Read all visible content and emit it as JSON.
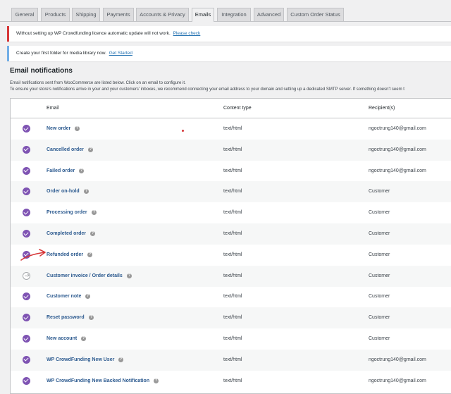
{
  "tabs": [
    {
      "label": "General"
    },
    {
      "label": "Products"
    },
    {
      "label": "Shipping"
    },
    {
      "label": "Payments"
    },
    {
      "label": "Accounts & Privacy"
    },
    {
      "label": "Emails"
    },
    {
      "label": "Integration"
    },
    {
      "label": "Advanced"
    },
    {
      "label": "Custom Order Status"
    }
  ],
  "active_tab": "Emails",
  "notices": {
    "licence_text": "Without setting up WP Crowdfunding licence automatic update will not work.",
    "licence_link": "Please check",
    "folder_text": "Create your first folder for media library now.",
    "folder_link": "Get Started"
  },
  "section": {
    "title": "Email notifications",
    "desc1": "Email notifications sent from WooCommerce are listed below. Click on an email to configure it.",
    "desc2": "To ensure your store's notifications arrive in your and your customers' inboxes, we recommend connecting your email address to your domain and setting up a dedicated SMTP server. If something doesn't seem t"
  },
  "table": {
    "headers": {
      "email": "Email",
      "content_type": "Content type",
      "recipients": "Recipient(s)"
    },
    "rows": [
      {
        "name": "New order",
        "type": "text/html",
        "recipient": "ngoctrung140@gmail.com",
        "status": "enabled"
      },
      {
        "name": "Cancelled order",
        "type": "text/html",
        "recipient": "ngoctrung140@gmail.com",
        "status": "enabled"
      },
      {
        "name": "Failed order",
        "type": "text/html",
        "recipient": "ngoctrung140@gmail.com",
        "status": "enabled"
      },
      {
        "name": "Order on-hold",
        "type": "text/html",
        "recipient": "Customer",
        "status": "enabled"
      },
      {
        "name": "Processing order",
        "type": "text/html",
        "recipient": "Customer",
        "status": "enabled"
      },
      {
        "name": "Completed order",
        "type": "text/html",
        "recipient": "Customer",
        "status": "enabled"
      },
      {
        "name": "Refunded order",
        "type": "text/html",
        "recipient": "Customer",
        "status": "enabled"
      },
      {
        "name": "Customer invoice / Order details",
        "type": "text/html",
        "recipient": "Customer",
        "status": "manual"
      },
      {
        "name": "Customer note",
        "type": "text/html",
        "recipient": "Customer",
        "status": "enabled"
      },
      {
        "name": "Reset password",
        "type": "text/html",
        "recipient": "Customer",
        "status": "enabled"
      },
      {
        "name": "New account",
        "type": "text/html",
        "recipient": "Customer",
        "status": "enabled"
      },
      {
        "name": "WP CrowdFunding New User",
        "type": "text/html",
        "recipient": "ngoctrung140@gmail.com",
        "status": "enabled"
      },
      {
        "name": "WP CrowdFunding New Backed Notification",
        "type": "text/html",
        "recipient": "ngoctrung140@gmail.com",
        "status": "enabled"
      }
    ]
  },
  "colors": {
    "accent": "#7f54b3",
    "link": "#2c5a8f",
    "annotation": "#d63638"
  }
}
